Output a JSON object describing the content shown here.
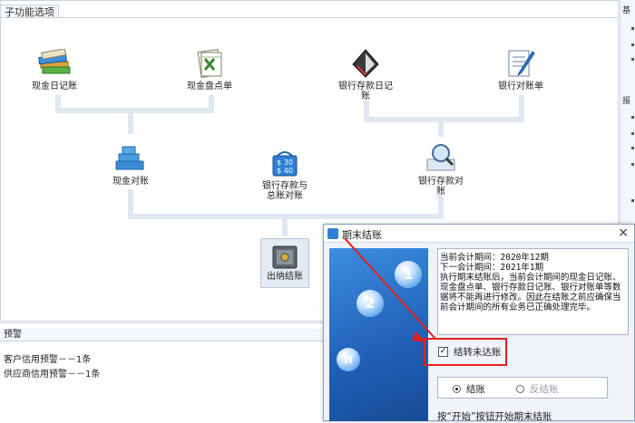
{
  "main_panel": {
    "tab_title": "子功能选项"
  },
  "nodes": {
    "cash_journal": "现金日记账",
    "cash_count": "现金盘点单",
    "bank_deposit_journal": "银行存款日记账",
    "bank_statement": "银行对账单",
    "cash_reconcile": "现金对账",
    "bank_vs_gl": "银行存款与总账对账",
    "bank_reconcile": "银行存款对账",
    "cashier_close": "出纳结账"
  },
  "right_strip": {
    "tab1": "基",
    "tab2": "报"
  },
  "warning_panel": {
    "title": "预警",
    "items": [
      "客户信用预警－－1条",
      "供应商信用预警－－1条"
    ]
  },
  "dialog": {
    "title": "期末结账",
    "close": "×",
    "info_text": "当前会计期间：2020年12期\n下一会计期间：2021年1期\n执行期末结账后，当前会计期间的现金日记账、现金盘点单、银行存款日记账、银行对账单等数据将不能再进行修改。因此在结账之前应确保当前会计期间的所有业务已正确处理完毕。",
    "checkbox_label": "结转未达账",
    "checkbox_checked": true,
    "radio_close": "结账",
    "radio_unclose": "反结账",
    "hint": "按“开始”按钮开始期末结账",
    "bubbles": [
      "1",
      "2",
      "n"
    ]
  },
  "colors": {
    "accent": "#2f7fd6",
    "annotation": "#e22020",
    "connector": "#dfe8f2"
  }
}
